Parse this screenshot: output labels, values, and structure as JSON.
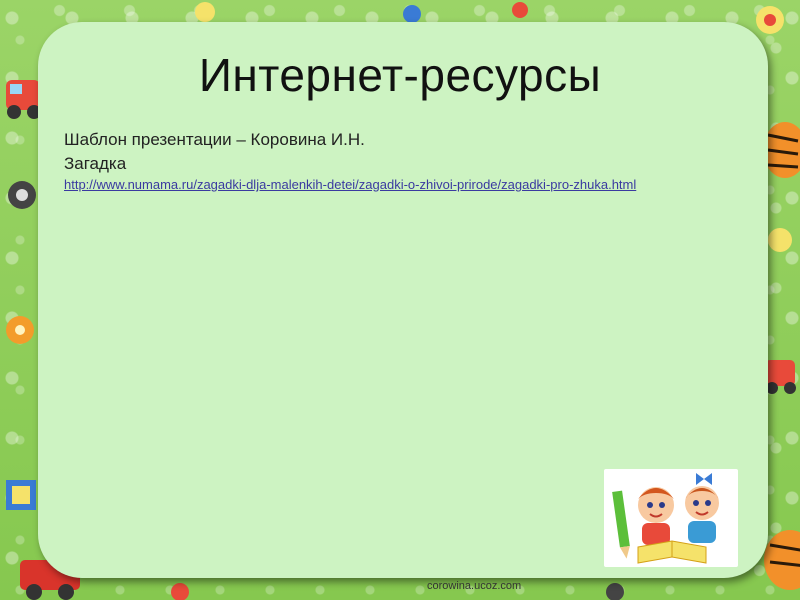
{
  "slide": {
    "title": "Интернет-ресурсы",
    "lines": [
      "Шаблон презентации – Коровина И.Н.",
      "Загадка"
    ],
    "link": "http://www.numama.ru/zagadki-dlja-malenkih-detei/zagadki-o-zhivoi-prirode/zagadki-pro-zhuka.html",
    "footer": "corowina.ucoz.com"
  },
  "colors": {
    "background": "#8fcf5a",
    "panel": "#cdf3c2",
    "link": "#3a3aa0"
  },
  "icons": [
    "toy-car-icon",
    "toy-tiger-icon",
    "toy-train-icon",
    "children-reading-illustration"
  ]
}
